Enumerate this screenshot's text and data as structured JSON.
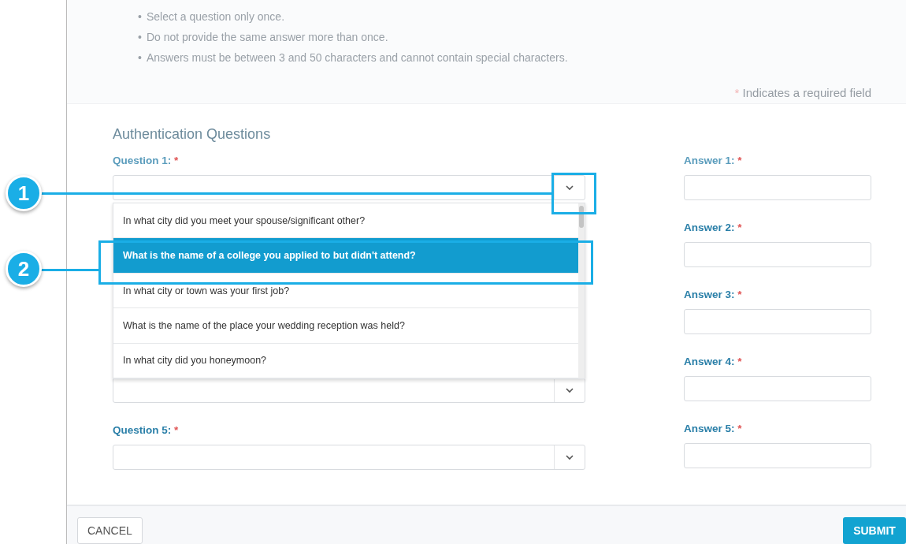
{
  "instructions": [
    {
      "bullet": "•",
      "text": "Select a question only once."
    },
    {
      "bullet": "•",
      "text": "Do not provide the same answer more than once."
    },
    {
      "bullet": "•",
      "text": "Answers must be between 3 and 50 characters and cannot contain special characters."
    }
  ],
  "required_note": {
    "mark": "*",
    "text": "Indicates a required field"
  },
  "section_title": "Authentication Questions",
  "questions": [
    {
      "label": "Question 1:",
      "required_mark": "*"
    },
    {
      "label": "Question 5:",
      "required_mark": "*"
    }
  ],
  "dropdown": {
    "options": [
      {
        "text": "In what city did you meet your spouse/significant other?",
        "selected": false
      },
      {
        "text": "What is the name of a college you applied to but didn't attend?",
        "selected": true
      },
      {
        "text": "In what city or town was your first job?",
        "selected": false
      },
      {
        "text": "What is the name of the place your wedding reception was held?",
        "selected": false
      },
      {
        "text": "In what city did you honeymoon?",
        "selected": false
      }
    ]
  },
  "answers": [
    {
      "label": "Answer 1:",
      "required_mark": "*"
    },
    {
      "label": "Answer 2:",
      "required_mark": "*"
    },
    {
      "label": "Answer 3:",
      "required_mark": "*"
    },
    {
      "label": "Answer 4:",
      "required_mark": "*"
    },
    {
      "label": "Answer 5:",
      "required_mark": "*"
    }
  ],
  "buttons": {
    "cancel": "CANCEL",
    "submit": "SUBMIT"
  },
  "callouts": [
    {
      "number": "1"
    },
    {
      "number": "2"
    }
  ]
}
